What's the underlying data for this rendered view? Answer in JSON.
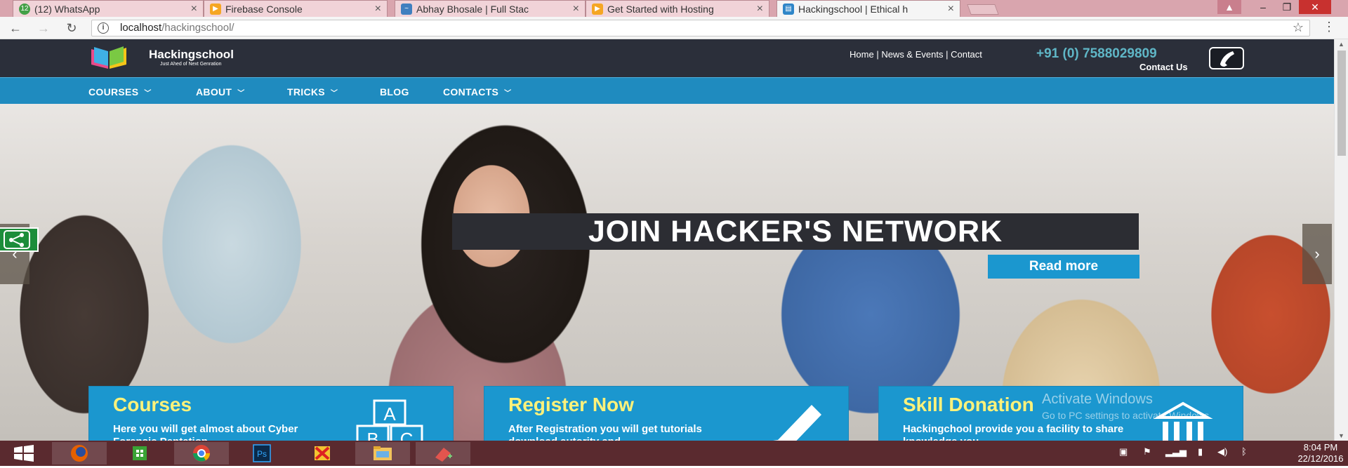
{
  "browser": {
    "tabs": [
      {
        "title": "(12) WhatsApp",
        "badge": "12"
      },
      {
        "title": "Firebase Console"
      },
      {
        "title": "Abhay Bhosale | Full Stac"
      },
      {
        "title": "Get Started with Hosting"
      },
      {
        "title": "Hackingschool | Ethical h",
        "active": true
      }
    ],
    "url_host": "localhost",
    "url_path": "/hackingschool/"
  },
  "site": {
    "brand": "Hackingschool",
    "tagline": "Just Ahed of Next Genration",
    "top_links": [
      "Home",
      "News & Events",
      "Contact"
    ],
    "phone": "+91 (0) 7588029809",
    "contact_us": "Contact Us",
    "nav": [
      {
        "label": "COURSES",
        "has_dropdown": true
      },
      {
        "label": "ABOUT",
        "has_dropdown": true
      },
      {
        "label": "TRICKS",
        "has_dropdown": true
      },
      {
        "label": "BLOG",
        "has_dropdown": false
      },
      {
        "label": "CONTACTS",
        "has_dropdown": true
      }
    ],
    "hero": {
      "title": "JOIN HACKER'S NETWORK",
      "button": "Read more"
    },
    "features": [
      {
        "title": "Courses",
        "text": "Here you will get almost about Cyber Forensic Pentation",
        "icon": "abc-blocks-icon"
      },
      {
        "title": "Register Now",
        "text": "After Registration you will get tutorials download autority and",
        "icon": "highlighter-icon"
      },
      {
        "title": "Skill Donation",
        "text": "Hackingchool provide you a facility to share knowledge you",
        "icon": "bank-building-icon"
      }
    ]
  },
  "watermark": {
    "line1": "Activate Windows",
    "line2": "Go to PC settings to activate Windows."
  },
  "taskbar": {
    "time": "8:04 PM",
    "date": "22/12/2016"
  },
  "colors": {
    "header_bg": "#2b2f3a",
    "nav_bg": "#1f8bbf",
    "accent": "#1b97cf",
    "feature_title": "#fff27a",
    "phone": "#5fb6c6"
  }
}
